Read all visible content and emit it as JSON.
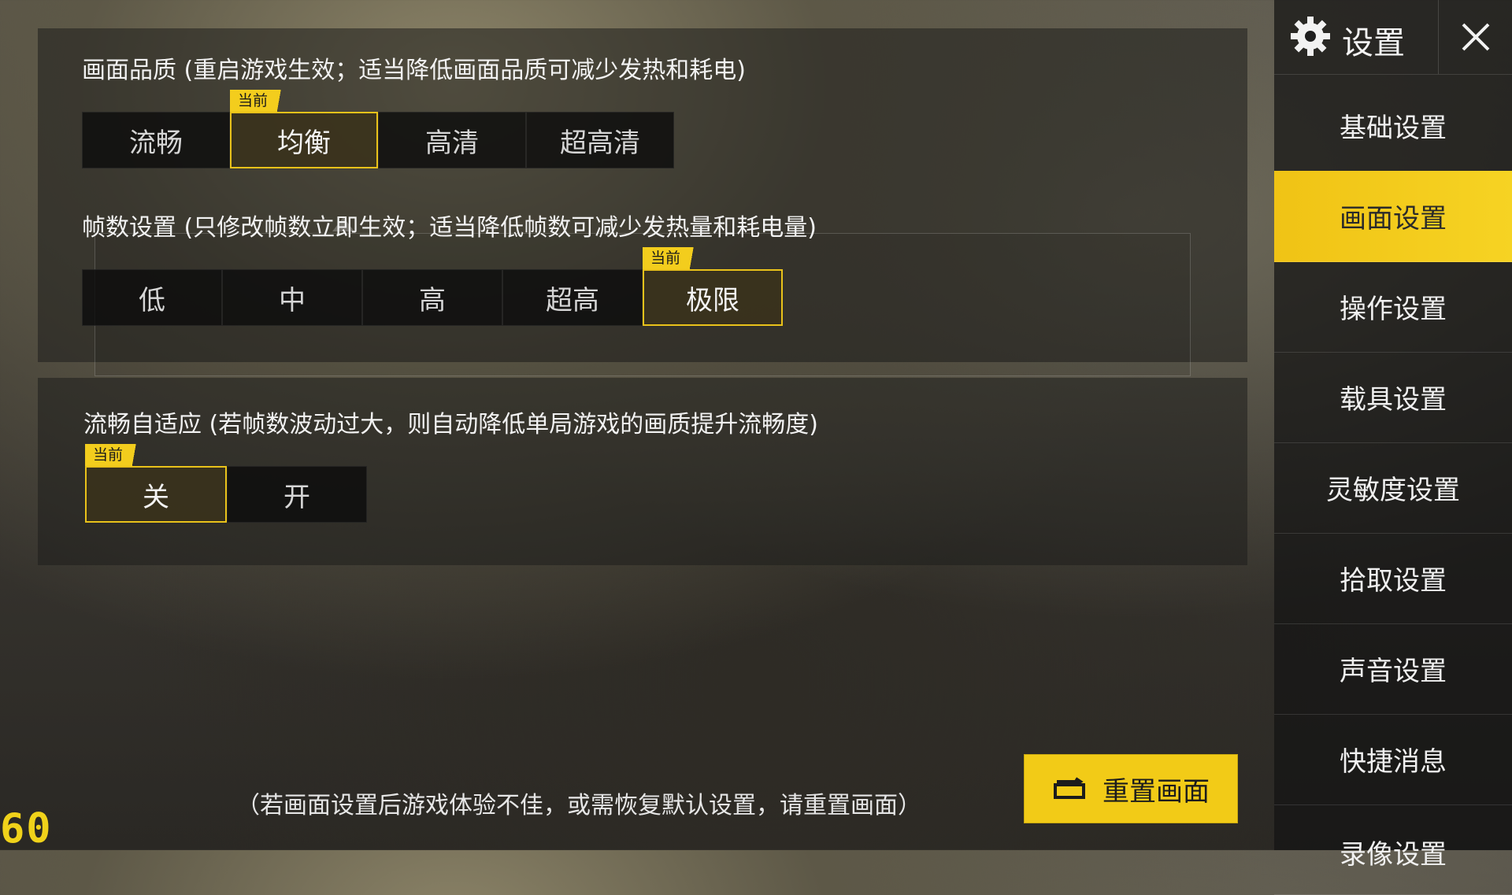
{
  "quality": {
    "title": "画面品质 (重启游戏生效；适当降低画面品质可减少发热和耗电)",
    "current_tag": "当前",
    "options": [
      "流畅",
      "均衡",
      "高清",
      "超高清"
    ],
    "selected": "均衡"
  },
  "framerate": {
    "title": "帧数设置 (只修改帧数立即生效；适当降低帧数可减少发热量和耗电量)",
    "current_tag": "当前",
    "options": [
      "低",
      "中",
      "高",
      "超高",
      "极限"
    ],
    "selected": "极限"
  },
  "adaptive": {
    "title": "流畅自适应 (若帧数波动过大，则自动降低单局游戏的画质提升流畅度)",
    "current_tag": "当前",
    "options": [
      "关",
      "开"
    ],
    "selected": "关"
  },
  "footer": {
    "hint": "（若画面设置后游戏体验不佳，或需恢复默认设置，请重置画面）",
    "reset_label": "重置画面"
  },
  "fps_counter": "60",
  "sidebar": {
    "title": "设置",
    "items": [
      "基础设置",
      "画面设置",
      "操作设置",
      "载具设置",
      "灵敏度设置",
      "拾取设置",
      "声音设置",
      "快捷消息",
      "录像设置"
    ],
    "active": "画面设置"
  },
  "colors": {
    "accent": "#F2CB17"
  }
}
